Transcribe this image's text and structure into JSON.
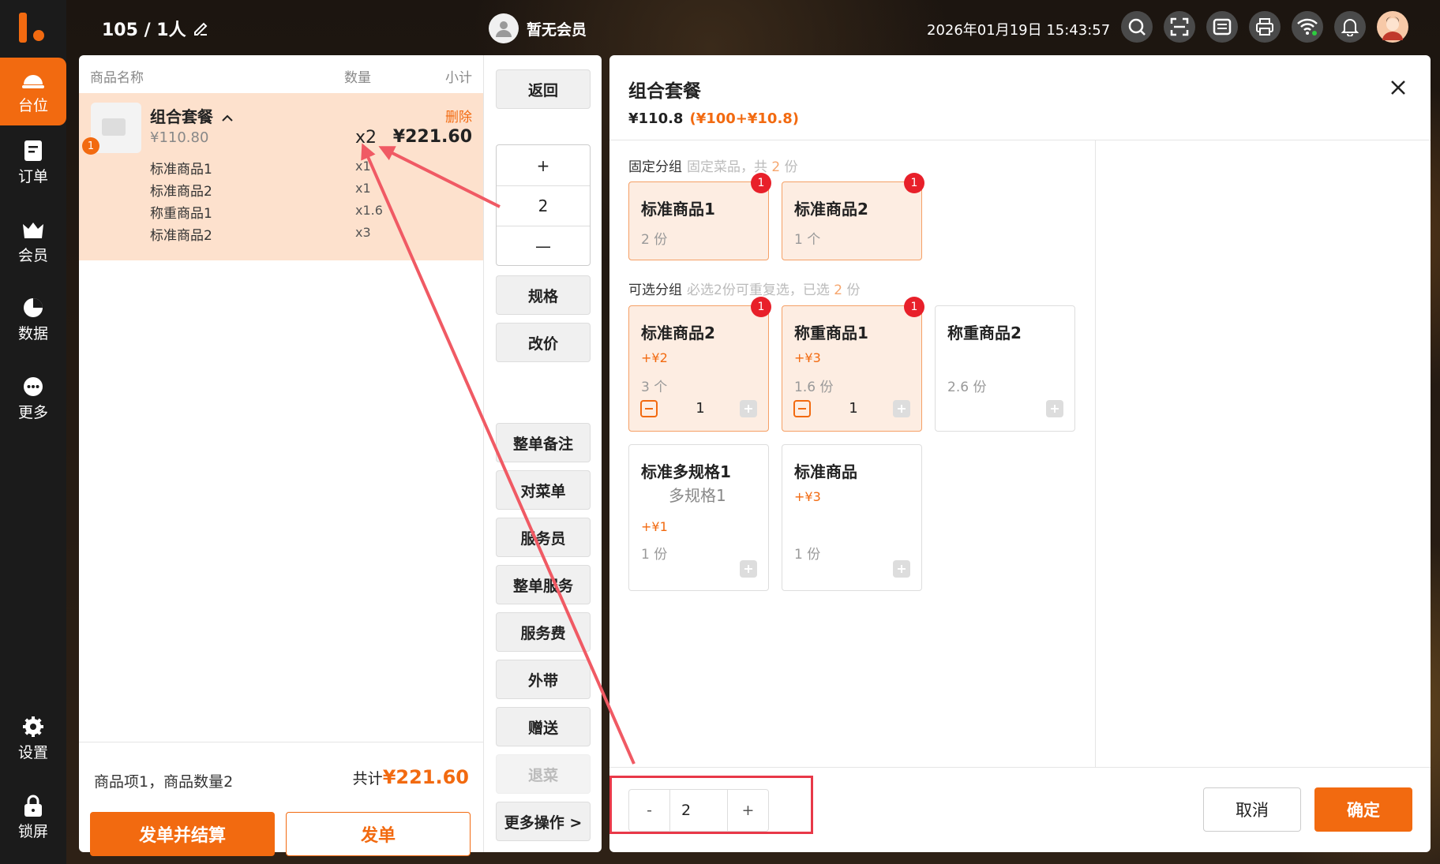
{
  "sidebar": {
    "items": [
      {
        "label": "台位",
        "icon": "table-bell-icon"
      },
      {
        "label": "订单",
        "icon": "order-icon"
      },
      {
        "label": "会员",
        "icon": "crown-icon"
      },
      {
        "label": "数据",
        "icon": "pie-chart-icon"
      },
      {
        "label": "更多",
        "icon": "more-icon"
      }
    ],
    "bottom_items": [
      {
        "label": "设置",
        "icon": "gear-icon"
      },
      {
        "label": "锁屏",
        "icon": "lock-icon"
      }
    ]
  },
  "topbar": {
    "table": "105 / 1人",
    "member": "暂无会员",
    "datetime": "2026年01月19日 15:43:57"
  },
  "order": {
    "headers": {
      "name": "商品名称",
      "qty": "数量",
      "subtotal": "小计"
    },
    "item": {
      "name": "组合套餐",
      "badge": "1",
      "price": "¥110.80",
      "qty": "x2",
      "subtotal": "¥221.60",
      "delete": "删除",
      "subs": [
        {
          "name": "标准商品1",
          "qty": "x1"
        },
        {
          "name": "标准商品2",
          "qty": "x1"
        },
        {
          "name": "称重商品1",
          "qty": "x1.6"
        },
        {
          "name": "标准商品2",
          "qty": "x3"
        }
      ]
    },
    "footer": {
      "summary": "商品项1，商品数量2",
      "total_label": "共计",
      "total": "¥221.60",
      "pay_button": "发单并结算",
      "send_button": "发单"
    }
  },
  "ops": {
    "back": "返回",
    "stepper": {
      "plus": "+",
      "value": "2",
      "minus": "—"
    },
    "spec": "规格",
    "reprice": "改价",
    "order_note": "整单备注",
    "check_menu": "对菜单",
    "waiter": "服务员",
    "order_service": "整单服务",
    "service_fee": "服务费",
    "takeaway": "外带",
    "gift": "赠送",
    "return_dish": "退菜",
    "more_ops": "更多操作 >"
  },
  "dialog": {
    "title": "组合套餐",
    "price": "¥110.8",
    "breakdown": "(¥100+¥10.8)",
    "fixed_group": {
      "label": "固定分组",
      "hint_prefix": "固定菜品，共",
      "hint_count": "2",
      "hint_suffix": "份"
    },
    "fixed_items": [
      {
        "name": "标准商品1",
        "qty": "2 份",
        "badge": "1"
      },
      {
        "name": "标准商品2",
        "qty": "1 个",
        "badge": "1"
      }
    ],
    "optional_group": {
      "label": "可选分组",
      "hint_prefix": "必选2份可重复选，已选",
      "hint_count": "2",
      "hint_suffix": "份"
    },
    "optional_items": [
      {
        "name": "标准商品2",
        "price": "+¥2",
        "qty": "3 个",
        "value": "1",
        "badge": "1",
        "selected": true
      },
      {
        "name": "称重商品1",
        "price": "+¥3",
        "qty": "1.6 份",
        "value": "1",
        "badge": "1",
        "selected": true
      },
      {
        "name": "称重商品2",
        "price": "",
        "qty": "2.6 份",
        "selected": false
      },
      {
        "name": "标准多规格1",
        "spec": "多规格1",
        "price": "+¥1",
        "qty": "1 份",
        "selected": false
      },
      {
        "name": "标准商品",
        "price": "+¥3",
        "qty": "1 份",
        "selected": false
      }
    ],
    "quantity": {
      "minus": "-",
      "value": "2",
      "plus": "+"
    },
    "cancel": "取消",
    "confirm": "确定"
  },
  "colors": {
    "accent": "#f26a10",
    "badge": "#e8202a",
    "annotation": "#e83848"
  }
}
